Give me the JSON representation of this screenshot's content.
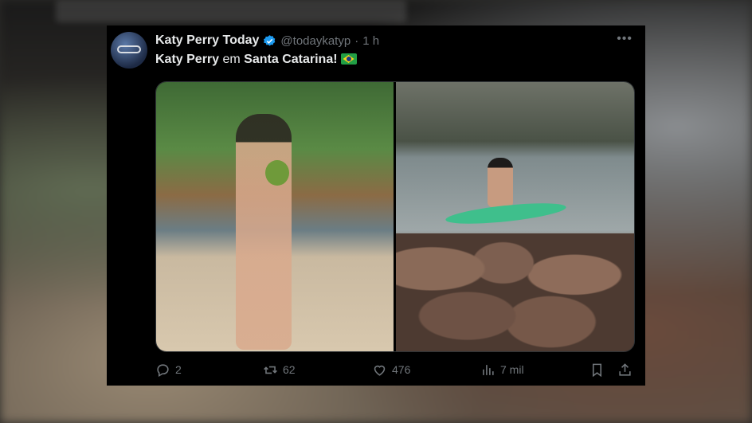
{
  "tweet": {
    "display_name": "Katy Perry Today",
    "handle": "@todaykatyp",
    "separator": "·",
    "time": "1 h",
    "more_label": "•••",
    "text_parts": [
      "Katy Perry",
      " em ",
      "Santa Catarina!"
    ],
    "flag_icon": "brazil-flag-icon"
  },
  "actions": {
    "replies": "2",
    "reposts": "62",
    "likes": "476",
    "views": "7 mil"
  },
  "colors": {
    "background": "#000000",
    "text": "#e7e9ea",
    "muted": "#71767b",
    "verified": "#1d9bf0"
  }
}
